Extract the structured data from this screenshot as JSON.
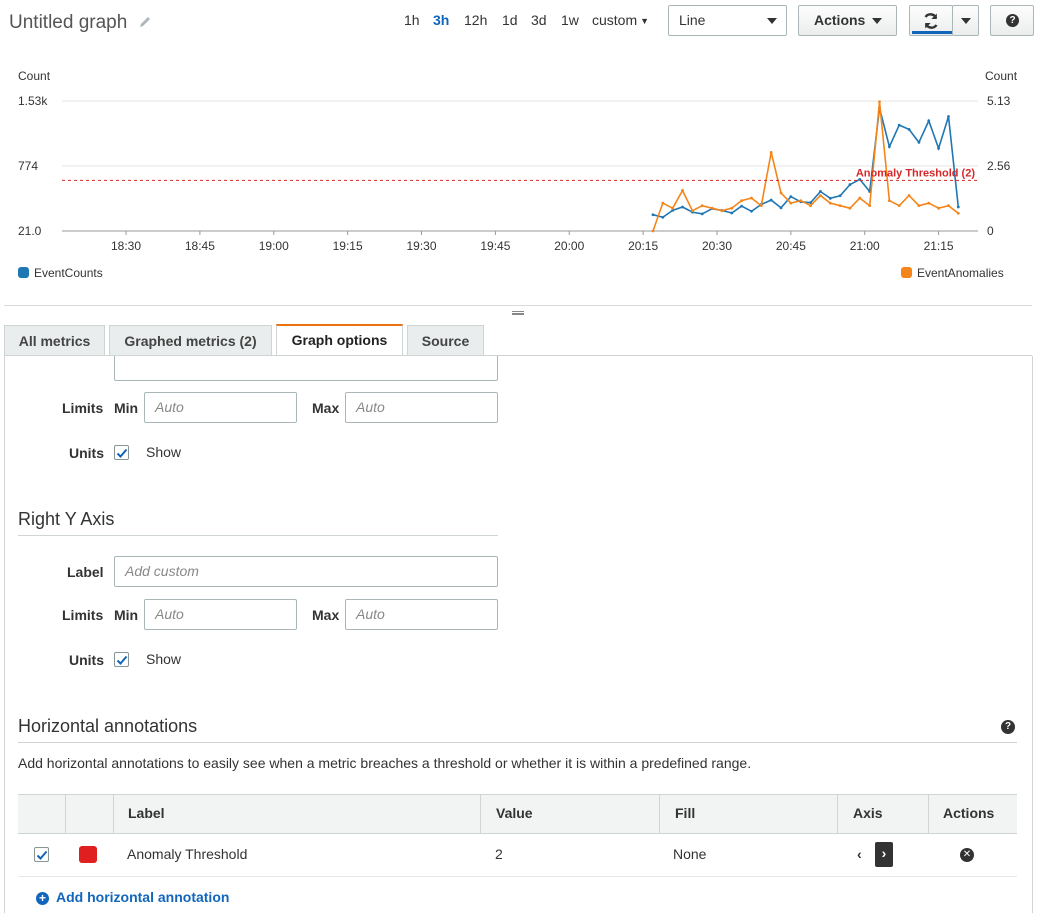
{
  "header": {
    "title": "Untitled graph",
    "time_ranges": [
      "1h",
      "3h",
      "12h",
      "1d",
      "3d",
      "1w"
    ],
    "active_range": "3h",
    "custom_label": "custom",
    "chart_type_select": "Line",
    "actions_label": "Actions"
  },
  "tabs": [
    {
      "label": "All metrics"
    },
    {
      "label": "Graphed metrics (2)"
    },
    {
      "label": "Graph options"
    },
    {
      "label": "Source"
    }
  ],
  "active_tab": "Graph options",
  "left_axis": {
    "limits_label": "Limits",
    "min_label": "Min",
    "max_label": "Max",
    "min_placeholder": "Auto",
    "max_placeholder": "Auto",
    "units_label": "Units",
    "units_checked": true,
    "show_label": "Show"
  },
  "right_axis": {
    "title": "Right Y Axis",
    "label_label": "Label",
    "label_placeholder": "Add custom",
    "limits_label": "Limits",
    "min_label": "Min",
    "max_label": "Max",
    "min_placeholder": "Auto",
    "max_placeholder": "Auto",
    "units_label": "Units",
    "units_checked": true,
    "show_label": "Show"
  },
  "annotations": {
    "title": "Horizontal annotations",
    "description": "Add horizontal annotations to easily see when a metric breaches a threshold or whether it is within a predefined range.",
    "columns": [
      "Label",
      "Value",
      "Fill",
      "Axis",
      "Actions"
    ],
    "rows": [
      {
        "checked": true,
        "color": "#e02020",
        "label": "Anomaly Threshold",
        "value": "2",
        "fill": "None",
        "axis": "right"
      }
    ],
    "add_label": "Add horizontal annotation"
  },
  "colors": {
    "accent_blue": "#1166bb",
    "tab_active_border": "#ec7211",
    "series_event_counts": "#1f77b4",
    "series_event_anomalies": "#f58518",
    "threshold": "#d62728"
  },
  "chart_data": {
    "type": "line",
    "left_axis_unit": "Count",
    "right_axis_unit": "Count",
    "left_ticks": [
      "1.53k",
      "774",
      "21.0"
    ],
    "right_ticks": [
      "5.13",
      "2.56",
      "0"
    ],
    "left_ylim": [
      21.0,
      1530
    ],
    "right_ylim": [
      0,
      5.13
    ],
    "x_ticks": [
      "18:30",
      "18:45",
      "19:00",
      "19:15",
      "19:30",
      "19:45",
      "20:00",
      "20:15",
      "20:30",
      "20:45",
      "21:00",
      "21:15"
    ],
    "x_range": [
      "18:17",
      "21:23"
    ],
    "threshold": {
      "label": "Anomaly Threshold (2)",
      "value": 2,
      "axis": "right"
    },
    "series": [
      {
        "name": "EventCounts",
        "axis": "left",
        "color": "#1f77b4",
        "x": [
          "20:17",
          "20:19",
          "20:21",
          "20:23",
          "20:25",
          "20:27",
          "20:29",
          "20:31",
          "20:33",
          "20:35",
          "20:37",
          "20:39",
          "20:41",
          "20:43",
          "20:45",
          "20:47",
          "20:49",
          "20:51",
          "20:53",
          "20:55",
          "20:57",
          "20:59",
          "21:01",
          "21:03",
          "21:05",
          "21:07",
          "21:09",
          "21:11",
          "21:13",
          "21:15",
          "21:17",
          "21:19"
        ],
        "values": [
          210,
          180,
          260,
          300,
          240,
          220,
          280,
          260,
          230,
          310,
          250,
          330,
          380,
          290,
          420,
          360,
          350,
          480,
          400,
          430,
          560,
          620,
          480,
          1450,
          1000,
          1250,
          1200,
          1050,
          1300,
          980,
          1350,
          300
        ]
      },
      {
        "name": "EventAnomalies",
        "axis": "right",
        "color": "#f58518",
        "x": [
          "20:17",
          "20:19",
          "20:21",
          "20:23",
          "20:25",
          "20:27",
          "20:29",
          "20:31",
          "20:33",
          "20:35",
          "20:37",
          "20:39",
          "20:41",
          "20:43",
          "20:45",
          "20:47",
          "20:49",
          "20:51",
          "20:53",
          "20:55",
          "20:57",
          "20:59",
          "21:01",
          "21:03",
          "21:05",
          "21:07",
          "21:09",
          "21:11",
          "21:13",
          "21:15",
          "21:17",
          "21:19"
        ],
        "values": [
          0,
          1.1,
          0.9,
          1.6,
          0.8,
          1.0,
          0.9,
          0.8,
          0.9,
          1.2,
          1.3,
          1.0,
          3.1,
          1.5,
          1.1,
          1.2,
          1.0,
          1.4,
          1.1,
          1.0,
          0.9,
          1.3,
          1.0,
          5.1,
          1.2,
          1.0,
          1.4,
          1.0,
          1.1,
          0.9,
          1.0,
          0.7
        ]
      }
    ]
  }
}
